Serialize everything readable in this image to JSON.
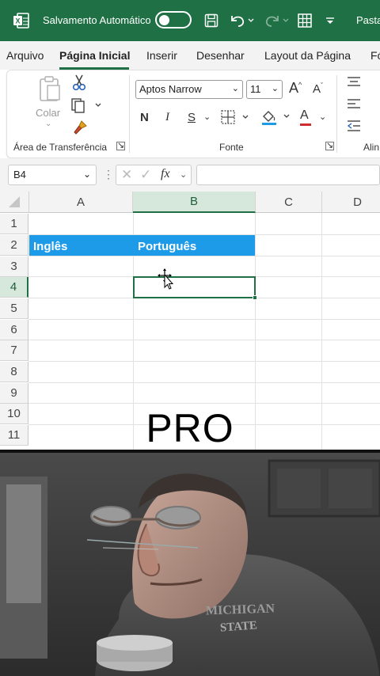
{
  "titlebar": {
    "autosave_label": "Salvamento Automático",
    "file_name": "Pasta"
  },
  "tabs": [
    "Arquivo",
    "Página Inicial",
    "Inserir",
    "Desenhar",
    "Layout da Página",
    "Fó"
  ],
  "ribbon": {
    "paste_label": "Colar",
    "font_name": "Aptos Narrow",
    "font_size": "11",
    "bold": "N",
    "italic": "I",
    "underline": "S",
    "grow_font": "A",
    "shrink_font": "A",
    "font_color": "A",
    "clipboard_group": "Área de Transferência",
    "font_group": "Fonte",
    "align_group": "Alin"
  },
  "formula_bar": {
    "name_box": "B4",
    "fx": "fx",
    "value": ""
  },
  "grid": {
    "columns": [
      "A",
      "B",
      "C",
      "D"
    ],
    "rows": [
      "1",
      "2",
      "3",
      "4",
      "5",
      "6",
      "7",
      "8",
      "9",
      "10",
      "11"
    ],
    "cells": {
      "A2": "Inglês",
      "B2": "Português"
    },
    "selected_cell": "B4"
  },
  "overlay_text": "PRO",
  "colors": {
    "excel_green": "#1f7145",
    "header_fill": "#1e9be8"
  },
  "icons": [
    "excel-logo-icon",
    "save-icon",
    "undo-icon",
    "redo-icon",
    "table-icon",
    "customize-icon",
    "cut-icon",
    "copy-icon",
    "format-painter-icon",
    "paste-icon",
    "move-cursor-icon"
  ]
}
